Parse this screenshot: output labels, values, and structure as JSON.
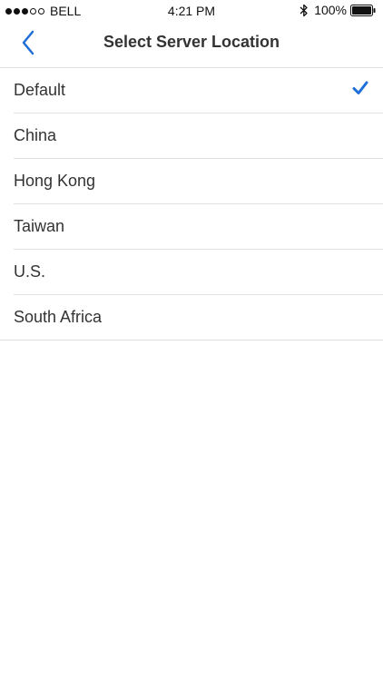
{
  "status_bar": {
    "signal_filled": 3,
    "signal_empty": 2,
    "carrier": "BELL",
    "time": "4:21 PM",
    "bluetooth_icon": "bluetooth-icon",
    "battery_percent": "100%",
    "battery_icon": "battery-full-icon"
  },
  "nav": {
    "back_icon": "chevron-left-icon",
    "title": "Select Server Location"
  },
  "locations": [
    {
      "label": "Default",
      "selected": true
    },
    {
      "label": "China",
      "selected": false
    },
    {
      "label": "Hong Kong",
      "selected": false
    },
    {
      "label": "Taiwan",
      "selected": false
    },
    {
      "label": "U.S.",
      "selected": false
    },
    {
      "label": "South Africa",
      "selected": false
    }
  ],
  "colors": {
    "accent": "#1f6fd8",
    "text": "#333333",
    "separator": "#e2e2e2"
  }
}
